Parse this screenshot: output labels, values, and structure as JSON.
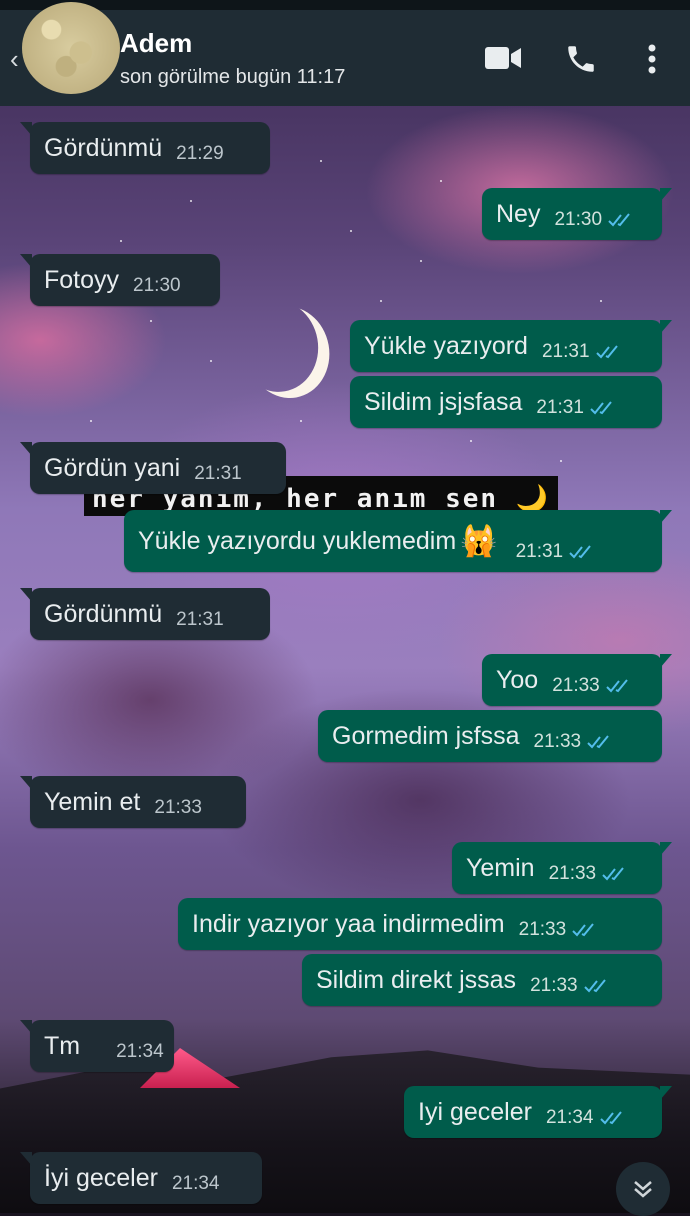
{
  "header": {
    "contact_name": "Adem",
    "last_seen": "son görülme bugün 11:17",
    "icons": [
      "back-arrow-icon",
      "avatar",
      "video-call-icon",
      "phone-icon",
      "more-options-icon"
    ]
  },
  "wallpaper_overlay": {
    "text": "her yanım, her anım sen",
    "emoji": "🌙"
  },
  "messages": [
    {
      "direction": "in",
      "text": "Gördünmü",
      "time": "21:29"
    },
    {
      "direction": "out",
      "text": "Ney",
      "time": "21:30",
      "read": true
    },
    {
      "direction": "in",
      "text": "Fotoyy",
      "time": "21:30"
    },
    {
      "direction": "out",
      "text": "Yükle yazıyord",
      "time": "21:31",
      "read": true
    },
    {
      "direction": "out",
      "text": "Sildim jsjsfasa",
      "time": "21:31",
      "read": true
    },
    {
      "direction": "in",
      "text": "Gördün yani",
      "time": "21:31"
    },
    {
      "direction": "out",
      "text": "Yükle yazıyordu yuklemedim",
      "emoji": "🙀",
      "time": "21:31",
      "read": true
    },
    {
      "direction": "in",
      "text": "Gördünmü",
      "time": "21:31"
    },
    {
      "direction": "out",
      "text": "Yoo",
      "time": "21:33",
      "read": true
    },
    {
      "direction": "out",
      "text": "Gormedim jsfssa",
      "time": "21:33",
      "read": true
    },
    {
      "direction": "in",
      "text": "Yemin et",
      "time": "21:33"
    },
    {
      "direction": "out",
      "text": "Yemin",
      "time": "21:33",
      "read": true
    },
    {
      "direction": "out",
      "text": "Indir yazıyor yaa indirmedim",
      "time": "21:33",
      "read": true
    },
    {
      "direction": "out",
      "text": "Sildim direkt jssas",
      "time": "21:33",
      "read": true
    },
    {
      "direction": "in",
      "text": "Tm",
      "time": "21:34"
    },
    {
      "direction": "out",
      "text": "Iyi geceler",
      "time": "21:34",
      "read": true
    },
    {
      "direction": "in",
      "text": "İyi geceler",
      "time": "21:34"
    }
  ],
  "colors": {
    "header_bg": "#1f2c34",
    "incoming_bubble": "#1f2c34",
    "outgoing_bubble": "#005c4b",
    "read_ticks": "#53bdeb"
  }
}
